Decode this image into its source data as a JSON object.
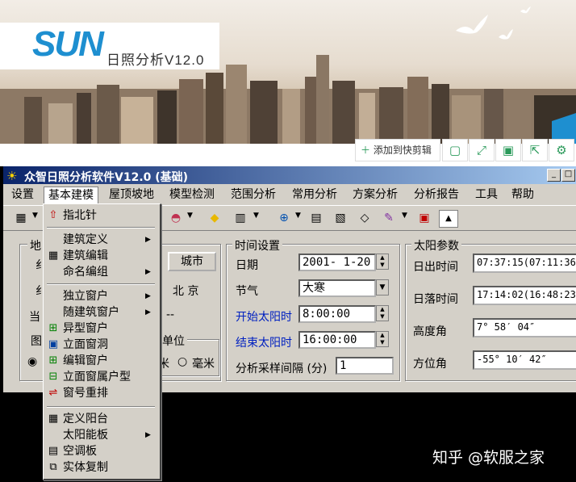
{
  "banner": {
    "logo": "SUN",
    "subtitle": "日照分析V12.0",
    "add_clip": "添加到快剪辑",
    "share_icons": [
      "screen-icon",
      "expand-icon",
      "save-icon",
      "export-icon",
      "settings-icon"
    ]
  },
  "window": {
    "title": "众智日照分析软件V12.0 (基础)",
    "controls": [
      "_",
      "□"
    ]
  },
  "menubar": [
    "设置",
    "基本建模",
    "屋顶坡地",
    "模型检测",
    "范围分析",
    "常用分析",
    "方案分析",
    "分析报告",
    "工具",
    "帮助"
  ],
  "dropdown": {
    "items": [
      {
        "icon": "北",
        "label": "指北针",
        "submenu": false
      },
      {
        "sep": true
      },
      {
        "icon": "",
        "label": "建筑定义",
        "submenu": true
      },
      {
        "icon": "▦",
        "label": "建筑编辑",
        "submenu": false
      },
      {
        "icon": "",
        "label": "命名编组",
        "submenu": true
      },
      {
        "sep": true
      },
      {
        "icon": "",
        "label": "独立窗户",
        "submenu": true
      },
      {
        "icon": "",
        "label": "随建筑窗户",
        "submenu": true
      },
      {
        "icon": "⊞",
        "label": "异型窗户",
        "submenu": false
      },
      {
        "icon": "▣",
        "label": "立面窗洞",
        "submenu": false
      },
      {
        "icon": "⊞",
        "label": "编辑窗户",
        "submenu": false
      },
      {
        "icon": "⊟",
        "label": "立面窗属户型",
        "submenu": false
      },
      {
        "icon": "⇌",
        "label": "窗号重排",
        "submenu": false
      },
      {
        "sep": true
      },
      {
        "icon": "▦",
        "label": "定义阳台",
        "submenu": false
      },
      {
        "icon": "",
        "label": "太阳能板",
        "submenu": true
      },
      {
        "icon": "▤",
        "label": "空调板",
        "submenu": false
      },
      {
        "icon": "⧉",
        "label": "实体复制",
        "submenu": false
      }
    ]
  },
  "left_panel": {
    "group_title_1": "地",
    "city_button": "城市",
    "city_value": "北 京",
    "dash": "--",
    "unit_title": "单位",
    "unit_meter": "米",
    "unit_mm": "毫米",
    "frag_1": "纟",
    "frag_2": "纟",
    "frag_3": "当",
    "frag_4": "图"
  },
  "time_settings": {
    "title": "时间设置",
    "date_label": "日期",
    "date_value": "2001- 1-20",
    "term_label": "节气",
    "term_value": "大寒",
    "start_label": "开始太阳时",
    "start_value": "8:00:00",
    "end_label": "结束太阳时",
    "end_value": "16:00:00",
    "interval_label": "分析采样间隔 (分)",
    "interval_value": "1"
  },
  "sun_params": {
    "title": "太阳参数",
    "sunrise_label": "日出时间",
    "sunrise_value": "07:37:15(07:11:36",
    "sunset_label": "日落时间",
    "sunset_value": "17:14:02(16:48:23",
    "altitude_label": "高度角",
    "altitude_value": "7° 58′ 04″",
    "azimuth_label": "方位角",
    "azimuth_value": "-55° 10′ 42″"
  },
  "watermark": "知乎 @软服之家"
}
